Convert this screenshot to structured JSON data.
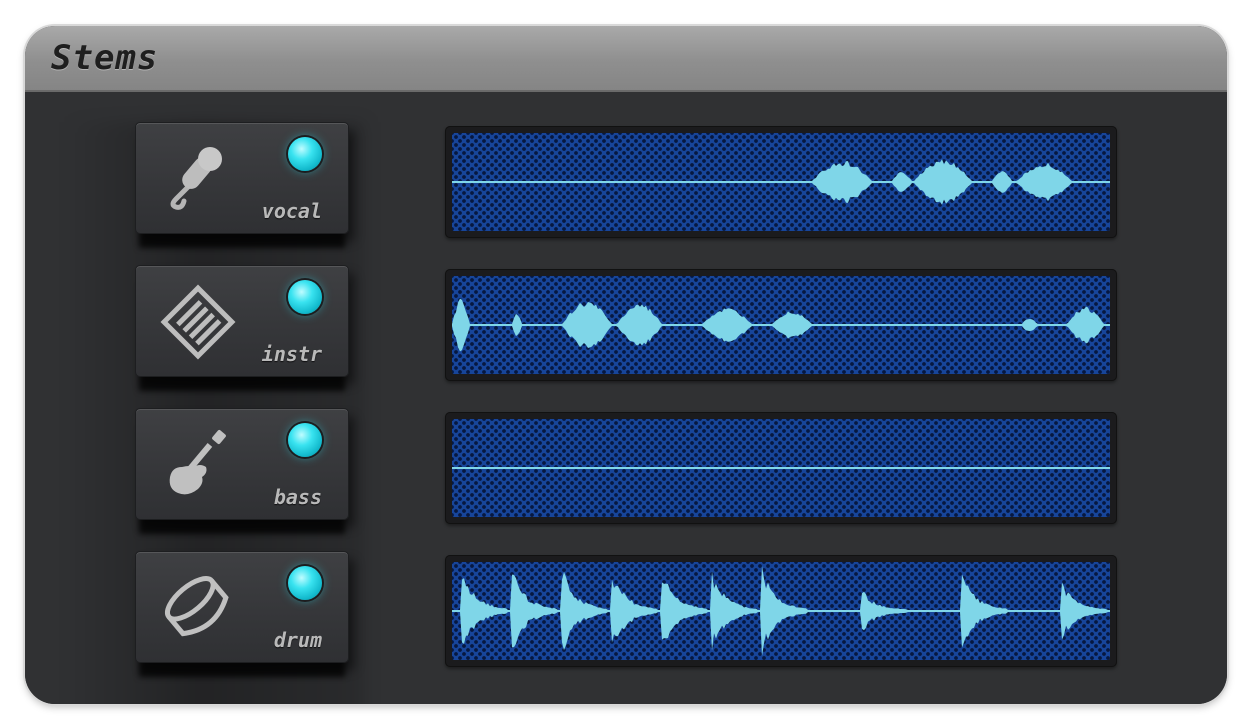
{
  "window": {
    "title": "Stems"
  },
  "stems": [
    {
      "label": "vocal",
      "icon": "microphone-icon",
      "active": true
    },
    {
      "label": "instr",
      "icon": "keyboard-icon",
      "active": true
    },
    {
      "label": "bass",
      "icon": "guitar-icon",
      "active": true
    },
    {
      "label": "drum",
      "icon": "drum-icon",
      "active": true
    }
  ],
  "colors": {
    "led_on": "#2fe3f2",
    "waveform": "#7fd6e8",
    "screen": "#17459a",
    "panel": "#2e2f31",
    "titlebar": "#969696"
  }
}
